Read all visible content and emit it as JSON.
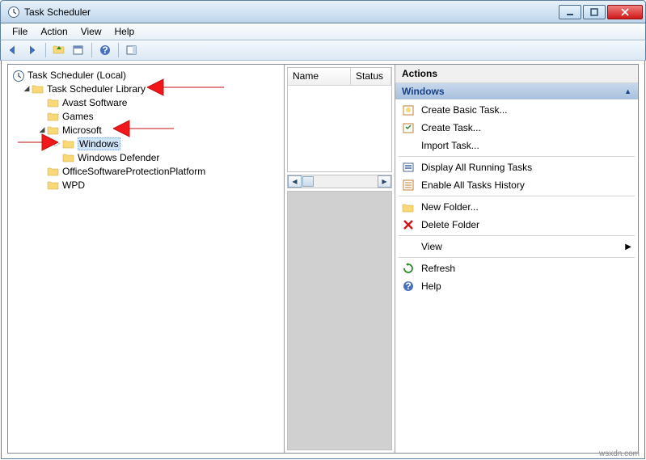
{
  "window": {
    "title": "Task Scheduler"
  },
  "menubar": {
    "items": [
      "File",
      "Action",
      "View",
      "Help"
    ]
  },
  "tree": {
    "root": "Task Scheduler (Local)",
    "library": "Task Scheduler Library",
    "items": {
      "avast": "Avast Software",
      "games": "Games",
      "microsoft": "Microsoft",
      "windows": "Windows",
      "defender": "Windows Defender",
      "ospp": "OfficeSoftwareProtectionPlatform",
      "wpd": "WPD"
    }
  },
  "middle": {
    "columns": [
      "Name",
      "Status"
    ]
  },
  "actions": {
    "title": "Actions",
    "context": "Windows",
    "items": {
      "create_basic": "Create Basic Task...",
      "create_task": "Create Task...",
      "import": "Import Task...",
      "display_running": "Display All Running Tasks",
      "enable_history": "Enable All Tasks History",
      "new_folder": "New Folder...",
      "delete_folder": "Delete Folder",
      "view": "View",
      "refresh": "Refresh",
      "help": "Help"
    }
  },
  "watermark": "wsxdn.com"
}
